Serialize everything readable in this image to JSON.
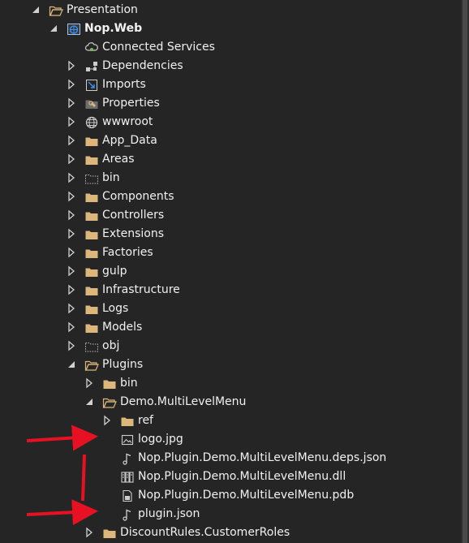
{
  "tree": [
    {
      "label": "Presentation",
      "icon": "folder-open-icon",
      "expander": "expanded"
    },
    {
      "label": "Nop.Web",
      "icon": "web-project-icon",
      "expander": "expanded",
      "bold": true
    },
    {
      "label": "Connected Services",
      "icon": "connected-services-icon",
      "expander": "none"
    },
    {
      "label": "Dependencies",
      "icon": "dependencies-icon",
      "expander": "collapsed"
    },
    {
      "label": "Imports",
      "icon": "imports-icon",
      "expander": "collapsed"
    },
    {
      "label": "Properties",
      "icon": "properties-icon",
      "expander": "collapsed"
    },
    {
      "label": "wwwroot",
      "icon": "globe-icon",
      "expander": "collapsed"
    },
    {
      "label": "App_Data",
      "icon": "folder-icon",
      "expander": "collapsed"
    },
    {
      "label": "Areas",
      "icon": "folder-icon",
      "expander": "collapsed"
    },
    {
      "label": "bin",
      "icon": "excluded-folder-icon",
      "expander": "collapsed"
    },
    {
      "label": "Components",
      "icon": "folder-icon",
      "expander": "collapsed"
    },
    {
      "label": "Controllers",
      "icon": "folder-icon",
      "expander": "collapsed"
    },
    {
      "label": "Extensions",
      "icon": "folder-icon",
      "expander": "collapsed"
    },
    {
      "label": "Factories",
      "icon": "folder-icon",
      "expander": "collapsed"
    },
    {
      "label": "gulp",
      "icon": "folder-icon",
      "expander": "collapsed"
    },
    {
      "label": "Infrastructure",
      "icon": "folder-icon",
      "expander": "collapsed"
    },
    {
      "label": "Logs",
      "icon": "folder-icon",
      "expander": "collapsed"
    },
    {
      "label": "Models",
      "icon": "folder-icon",
      "expander": "collapsed"
    },
    {
      "label": "obj",
      "icon": "excluded-folder-icon",
      "expander": "collapsed"
    },
    {
      "label": "Plugins",
      "icon": "folder-open-icon",
      "expander": "expanded"
    },
    {
      "label": "bin",
      "icon": "folder-icon",
      "expander": "collapsed"
    },
    {
      "label": "Demo.MultiLevelMenu",
      "icon": "folder-open-icon",
      "expander": "expanded"
    },
    {
      "label": "ref",
      "icon": "folder-icon",
      "expander": "collapsed"
    },
    {
      "label": "logo.jpg",
      "icon": "image-file-icon",
      "expander": "none"
    },
    {
      "label": "Nop.Plugin.Demo.MultiLevelMenu.deps.json",
      "icon": "json-file-icon",
      "expander": "none"
    },
    {
      "label": "Nop.Plugin.Demo.MultiLevelMenu.dll",
      "icon": "dll-file-icon",
      "expander": "none"
    },
    {
      "label": "Nop.Plugin.Demo.MultiLevelMenu.pdb",
      "icon": "pdb-file-icon",
      "expander": "none"
    },
    {
      "label": "plugin.json",
      "icon": "json-file-icon",
      "expander": "none"
    },
    {
      "label": "DiscountRules.CustomerRoles",
      "icon": "folder-icon",
      "expander": "collapsed"
    }
  ],
  "annotations": [
    {
      "name": "red-arrow-logo",
      "points_to": "logo.jpg",
      "color": "#e81123"
    },
    {
      "name": "red-arrow-plugin-json",
      "points_to": "plugin.json",
      "color": "#e81123"
    }
  ],
  "colors": {
    "background": "#252526",
    "text": "#f1f1f1",
    "folder": "#dcb67a",
    "expander": "#d0d0d0",
    "annotation": "#e81123"
  }
}
